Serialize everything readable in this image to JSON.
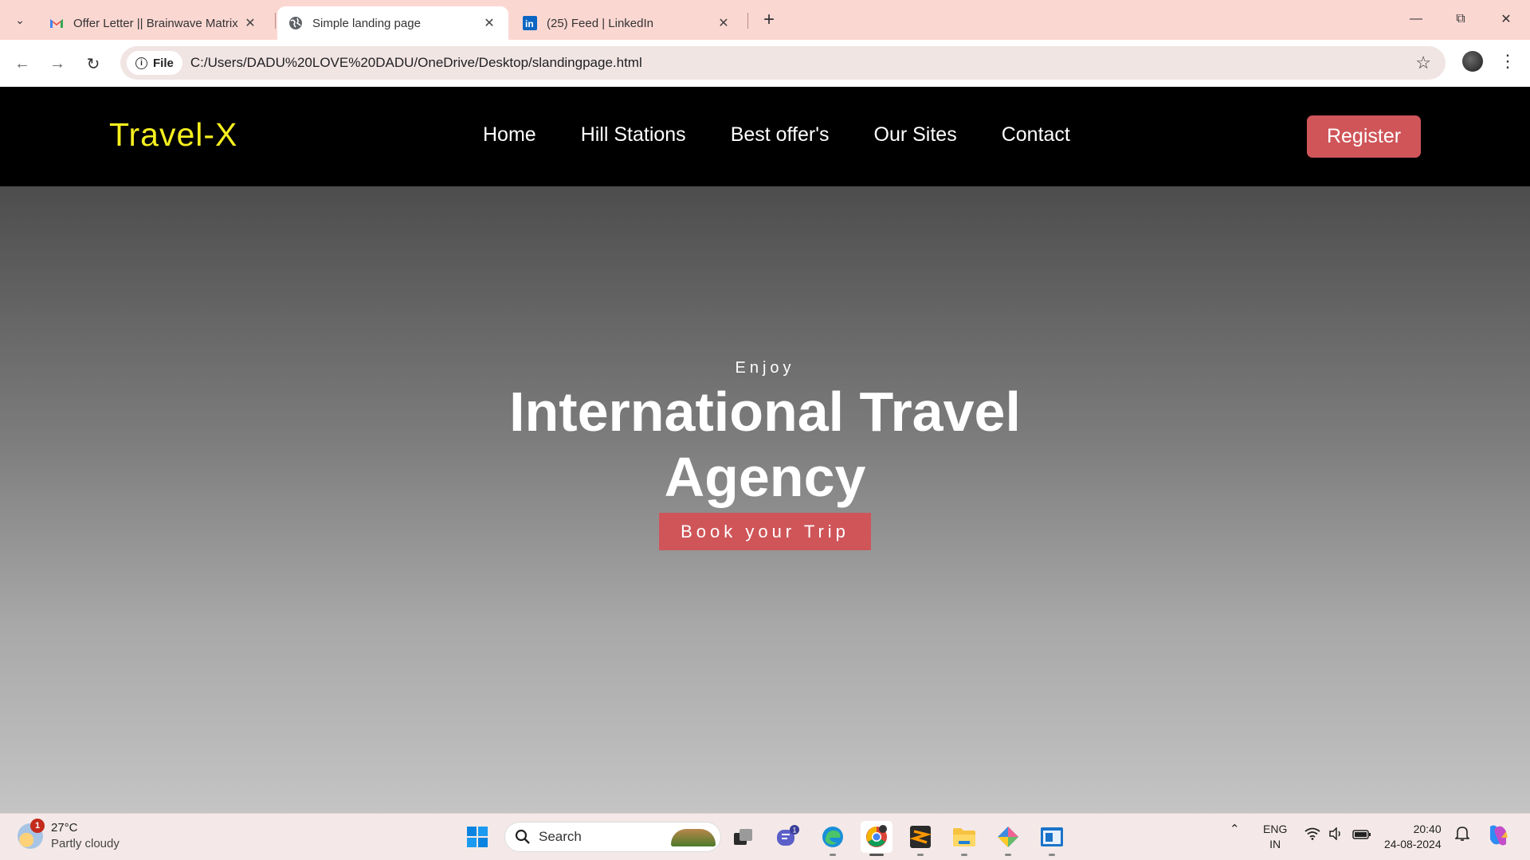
{
  "browser": {
    "tabs": [
      {
        "title": "Offer Letter || Brainwave Matrix",
        "favicon": "gmail-icon",
        "active": false
      },
      {
        "title": "Simple landing page",
        "favicon": "globe-icon",
        "active": true
      },
      {
        "title": "(25) Feed | LinkedIn",
        "favicon": "linkedin-icon",
        "active": false
      }
    ],
    "new_tab": "+",
    "chip_label": "File",
    "url": "C:/Users/DADU%20LOVE%20DADU/OneDrive/Desktop/slandingpage.html"
  },
  "site": {
    "logo": "Travel-X",
    "menu": [
      "Home",
      "Hill Stations",
      "Best offer's",
      "Our Sites",
      "Contact"
    ],
    "register": "Register",
    "hero": {
      "kicker": "Enjoy",
      "headline_line1": "International Travel",
      "headline_line2": "Agency",
      "cta": "Book your Trip"
    }
  },
  "taskbar": {
    "weather_temp": "27°C",
    "weather_desc": "Partly cloudy",
    "weather_badge": "1",
    "search_placeholder": "Search",
    "teams_badge": "1",
    "lang_top": "ENG",
    "lang_bottom": "IN",
    "time": "20:40",
    "date": "24-08-2024"
  },
  "colors": {
    "accent": "#cf5559",
    "logo": "#f6ef1f",
    "tabstrip": "#fbd7d2"
  }
}
